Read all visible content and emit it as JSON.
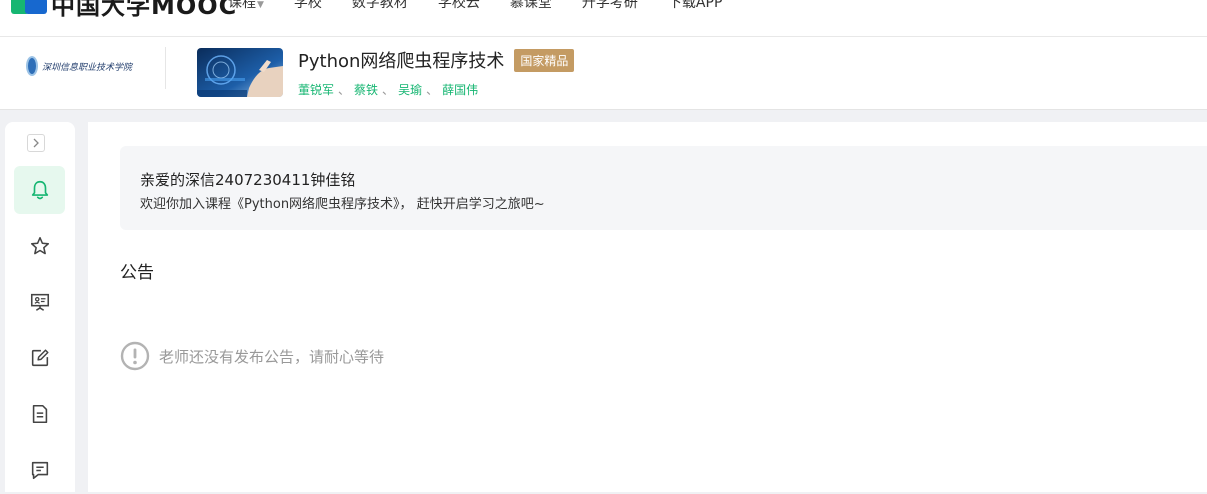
{
  "topnav": {
    "brand": "中国大学MOOC",
    "items": [
      "课程",
      "学校",
      "数字教材",
      "学校云",
      "慕课堂",
      "升学考研",
      "下载APP"
    ]
  },
  "course": {
    "school_logo_text": "深圳信息职业技术学院",
    "title": "Python网络爬虫程序技术",
    "badge": "国家精品",
    "teachers": [
      "董锐军",
      "蔡铁",
      "吴瑜",
      "薛国伟"
    ],
    "teacher_separator": "、"
  },
  "sidebar": {
    "items": [
      {
        "icon": "bell-icon",
        "active": true
      },
      {
        "icon": "star-icon",
        "active": false
      },
      {
        "icon": "presentation-icon",
        "active": false
      },
      {
        "icon": "edit-icon",
        "active": false
      },
      {
        "icon": "document-icon",
        "active": false
      },
      {
        "icon": "message-icon",
        "active": false
      }
    ]
  },
  "welcome": {
    "name": "亲爱的深信2407230411钟佳铭",
    "message": "欢迎你加入课程《Python网络爬虫程序技术》， 赶快开启学习之旅吧~"
  },
  "announcements": {
    "title": "公告",
    "empty_text": "老师还没有发布公告，请耐心等待"
  },
  "colors": {
    "brand_green": "#16b672",
    "brand_blue": "#1768cf",
    "badge": "#c49b63",
    "active_bg": "#e6f8ee"
  }
}
